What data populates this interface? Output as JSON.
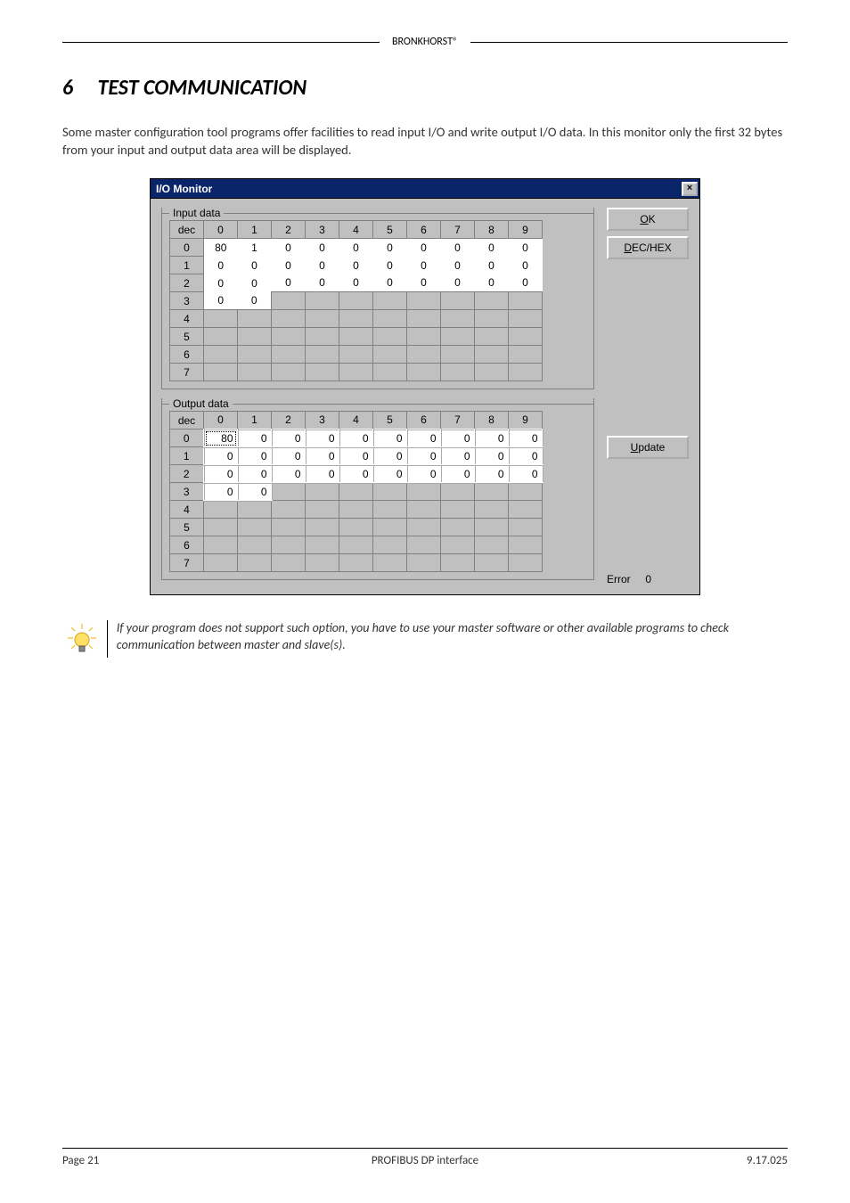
{
  "header": {
    "brand": "BRONKHORST®"
  },
  "section": {
    "number": "6",
    "title": "TEST COMMUNICATION"
  },
  "paragraph1": "Some master configuration tool programs offer facilities to read input I/O and write output I/O data. In this monitor only the first 32 bytes from your input and output data area will be displayed.",
  "dialog": {
    "title": "I/O Monitor",
    "close_tooltip": "Close",
    "ok_label": "OK",
    "dechex_label": "DEC/HEX",
    "update_label": "Update",
    "input_legend": "Input data",
    "output_legend": "Output data",
    "row_header_label": "dec",
    "col_headers": [
      "0",
      "1",
      "2",
      "3",
      "4",
      "5",
      "6",
      "7",
      "8",
      "9"
    ],
    "row_headers": [
      "0",
      "1",
      "2",
      "3",
      "4",
      "5",
      "6",
      "7"
    ],
    "input_rows": [
      [
        80,
        1,
        0,
        0,
        0,
        0,
        0,
        0,
        0,
        0
      ],
      [
        0,
        0,
        0,
        0,
        0,
        0,
        0,
        0,
        0,
        0
      ],
      [
        0,
        0,
        0,
        0,
        0,
        0,
        0,
        0,
        0,
        0
      ],
      [
        0,
        0,
        null,
        null,
        null,
        null,
        null,
        null,
        null,
        null
      ],
      [
        null,
        null,
        null,
        null,
        null,
        null,
        null,
        null,
        null,
        null
      ],
      [
        null,
        null,
        null,
        null,
        null,
        null,
        null,
        null,
        null,
        null
      ],
      [
        null,
        null,
        null,
        null,
        null,
        null,
        null,
        null,
        null,
        null
      ],
      [
        null,
        null,
        null,
        null,
        null,
        null,
        null,
        null,
        null,
        null
      ]
    ],
    "output_rows": [
      [
        80,
        0,
        0,
        0,
        0,
        0,
        0,
        0,
        0,
        0
      ],
      [
        0,
        0,
        0,
        0,
        0,
        0,
        0,
        0,
        0,
        0
      ],
      [
        0,
        0,
        0,
        0,
        0,
        0,
        0,
        0,
        0,
        0
      ],
      [
        0,
        0,
        null,
        null,
        null,
        null,
        null,
        null,
        null,
        null
      ],
      [
        null,
        null,
        null,
        null,
        null,
        null,
        null,
        null,
        null,
        null
      ],
      [
        null,
        null,
        null,
        null,
        null,
        null,
        null,
        null,
        null,
        null
      ],
      [
        null,
        null,
        null,
        null,
        null,
        null,
        null,
        null,
        null,
        null
      ],
      [
        null,
        null,
        null,
        null,
        null,
        null,
        null,
        null,
        null,
        null
      ]
    ],
    "error_label": "Error",
    "error_value": "0"
  },
  "tip": {
    "icon_name": "lightbulb-icon",
    "text": "If your program does not support such option, you have to use your master software or other available programs to check communication between master and slave(s)."
  },
  "footer": {
    "left": "Page 21",
    "center": "PROFIBUS DP interface",
    "right": "9.17.025"
  }
}
